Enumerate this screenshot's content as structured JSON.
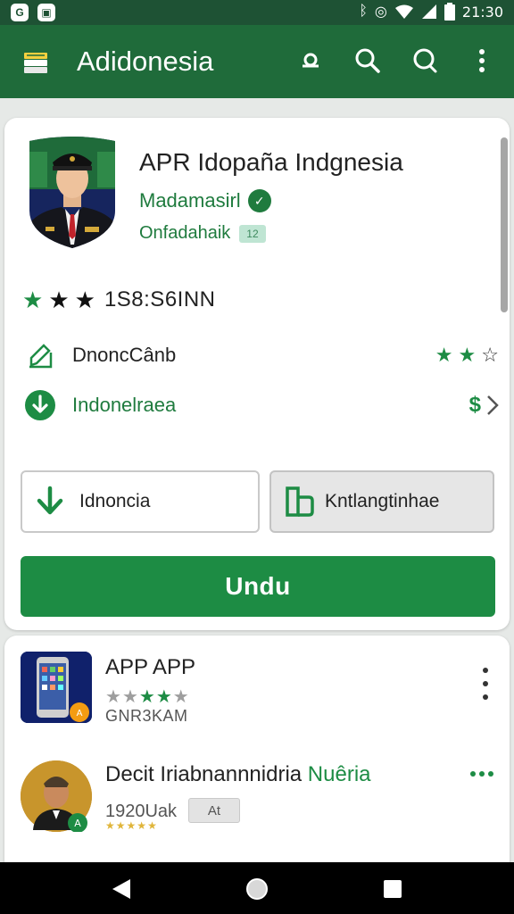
{
  "status_bar": {
    "time": "21:30",
    "left_icons": [
      "gmail-icon",
      "notification-icon"
    ],
    "right_icons": [
      "bluetooth-icon",
      "vibrate-icon",
      "wifi-icon",
      "signal-icon",
      "battery-icon"
    ]
  },
  "app_bar": {
    "title": "Adidonesia",
    "actions": [
      "search-alt-icon",
      "search-icon",
      "search-outline-icon",
      "more-vert-icon"
    ]
  },
  "app_detail": {
    "title": "APR Idopaña Indgnesia",
    "developer": "Madamasirl",
    "category": "Onfadahaik",
    "category_badge": "12",
    "rating_text": "1S8:S6INN",
    "rating_stars": 3,
    "info_rows": [
      {
        "label": "DnoncCânb",
        "trail_stars": 3
      },
      {
        "label": "Indonelraea",
        "trail_text": "$"
      }
    ],
    "buttons": {
      "outline": "Idnoncia",
      "secondary": "Kntlangtinhae",
      "primary": "Undu"
    }
  },
  "list": {
    "items": [
      {
        "title": "APP APP",
        "subtitle": "GNR3KAM",
        "rating": 4
      },
      {
        "title_main": "Decit Iriabnannnidria ",
        "title_accent": "Nuêria",
        "subtitle": "1920Uak",
        "chip": "At",
        "rating": 5
      }
    ]
  },
  "colors": {
    "primary": "#1f6b3a",
    "accent": "#1d8c44",
    "status_bar": "#1e5234"
  }
}
